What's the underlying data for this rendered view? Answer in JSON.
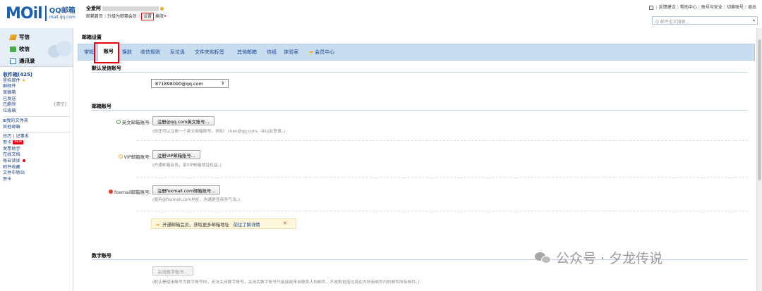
{
  "app": {
    "logo_word": "MOil",
    "logo_name": "QQ邮箱",
    "logo_url": "mail.qq.com"
  },
  "header": {
    "user_name": "全爱阿",
    "links": [
      "邮箱首页",
      "升级为邮箱会员",
      "设置",
      "换肤"
    ],
    "right_links": [
      "反馈建议",
      "帮助中心",
      "账号与安全",
      "切换账号",
      "退出"
    ],
    "search_placeholder": "Q 邮件全文搜索..."
  },
  "sidebar": {
    "actions": {
      "write": "写信",
      "inbox": "收信",
      "contacts": "通讯录"
    },
    "folders": {
      "inbox": "收件箱(425)",
      "starred": "星标邮件",
      "groups": "群邮件",
      "drafts": "草稿箱",
      "sent": "已发送",
      "deleted": "已删除",
      "clear": "[清空]",
      "spam": "垃圾箱",
      "my_folders": "⊞我的文件夹",
      "other": "其他邮箱",
      "calendar": "日历",
      "notes": "记事本",
      "postcard": "贺卡",
      "new": "NEW",
      "deliverer": "发票助手",
      "docs": "在线文档",
      "subscribe": "每日读读",
      "attachments": "附件收藏",
      "transfer": "文件中转站",
      "card": "贺卡"
    }
  },
  "main": {
    "title": "邮箱设置",
    "tabs": [
      "常规",
      "账号",
      "换肤",
      "收信规则",
      "反垃圾",
      "文件夹和标签",
      "其他邮箱",
      "信纸",
      "体验室",
      "会员中心"
    ],
    "active_tab": "账号",
    "sections": {
      "default_sender": {
        "title": "默认发信账号",
        "selected": "871898090@qq.com"
      },
      "mail_accounts": {
        "title": "邮箱账号",
        "english": {
          "label": "英文邮箱账号:",
          "button": "注册@qq.com英文账号...",
          "hint": "(你还可以注册一个英文邮箱账号。例如：chen@qq.com，并以此登录。)"
        },
        "vip": {
          "label": "VIP邮箱账号:",
          "button": "注册VIP邮箱账号...",
          "hint": "(开通邮箱会员，享VIP邮箱地址权益。)"
        },
        "foxmail": {
          "label": "foxmail邮箱账号:",
          "button": "注册foxmail.com邮箱账号...",
          "hint": "(使用@foxmail.com地址，沟通更显商务气派。)"
        },
        "promo": {
          "text": "开通邮箱会员，获取更多邮箱地址",
          "link": "前往了解详情",
          "close": "✕"
        }
      },
      "digital": {
        "title": "数字账号",
        "button": "关闭数字账号...",
        "hint": "(默认是使用账号为数字账号时，无法关闭数字账号。关闭后数字账号只能接收来自联系人的邮件，不收取包括垃圾在内所有邮件内的邮件所有邮件。)"
      }
    }
  },
  "watermark": "公众号 · 夕龙传说",
  "colors": {
    "accent": "#1b5fb1",
    "tab_bar": "#c9ddf0",
    "highlight": "#e60012",
    "link": "#16438f"
  }
}
